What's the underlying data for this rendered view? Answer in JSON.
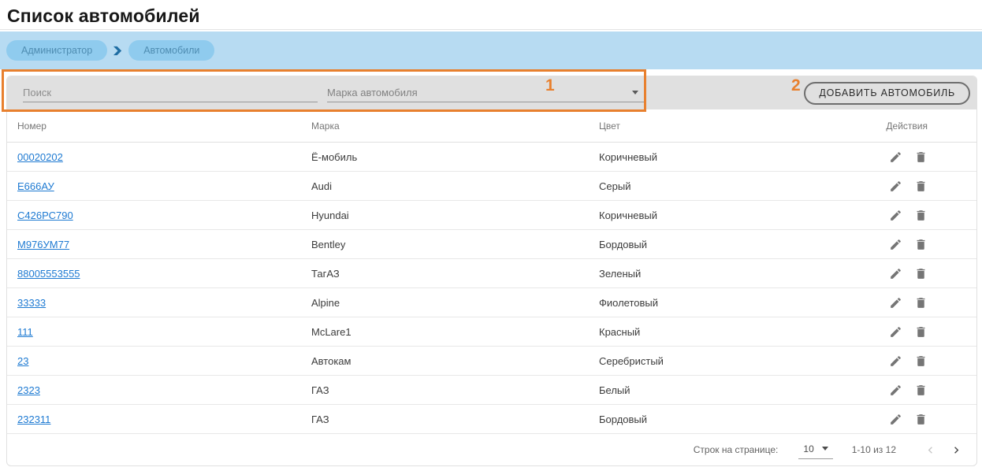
{
  "page": {
    "title": "Список автомобилей"
  },
  "breadcrumb": {
    "items": [
      {
        "label": "Администратор"
      },
      {
        "label": "Автомобили"
      }
    ]
  },
  "toolbar": {
    "search_placeholder": "Поиск",
    "search_value": "",
    "brand_select_placeholder": "Марка автомобиля",
    "add_button_label": "ДОБАВИТЬ АВТОМОБИЛЬ"
  },
  "annotations": {
    "one": "1",
    "two": "2",
    "accent_color": "#e8802e"
  },
  "table": {
    "columns": [
      "Номер",
      "Марка",
      "Цвет",
      "Действия"
    ],
    "rows": [
      {
        "number": "00020202",
        "brand": "Ё-мобиль",
        "color": "Коричневый"
      },
      {
        "number": "Е666АУ",
        "brand": "Audi",
        "color": "Серый"
      },
      {
        "number": "С426РС790",
        "brand": "Hyundai",
        "color": "Коричневый"
      },
      {
        "number": "М976УМ77",
        "brand": "Bentley",
        "color": "Бордовый"
      },
      {
        "number": "88005553555",
        "brand": "ТагАЗ",
        "color": "Зеленый"
      },
      {
        "number": "33333",
        "brand": "Alpine",
        "color": "Фиолетовый"
      },
      {
        "number": "111",
        "brand": "McLare1",
        "color": "Красный"
      },
      {
        "number": "23",
        "brand": "Автокам",
        "color": "Серебристый"
      },
      {
        "number": "2323",
        "brand": "ГАЗ",
        "color": "Белый"
      },
      {
        "number": "232311",
        "brand": "ГАЗ",
        "color": "Бордовый"
      }
    ],
    "row_actions": [
      {
        "icon": "pencil-edit-icon"
      },
      {
        "icon": "trash-delete-icon"
      }
    ]
  },
  "pagination": {
    "rows_per_page_label": "Строк на странице:",
    "rows_per_page_value": "10",
    "range_label": "1-10 из 12"
  },
  "colors": {
    "band_blue": "#b7dbf2",
    "chip_blue": "#8fcbee",
    "chip_text_blue": "#4f8db2",
    "link_blue": "#1e7ad2",
    "toolbar_gray": "#e0e0e0",
    "icon_gray": "#757575",
    "annotation_orange": "#e8802e"
  }
}
